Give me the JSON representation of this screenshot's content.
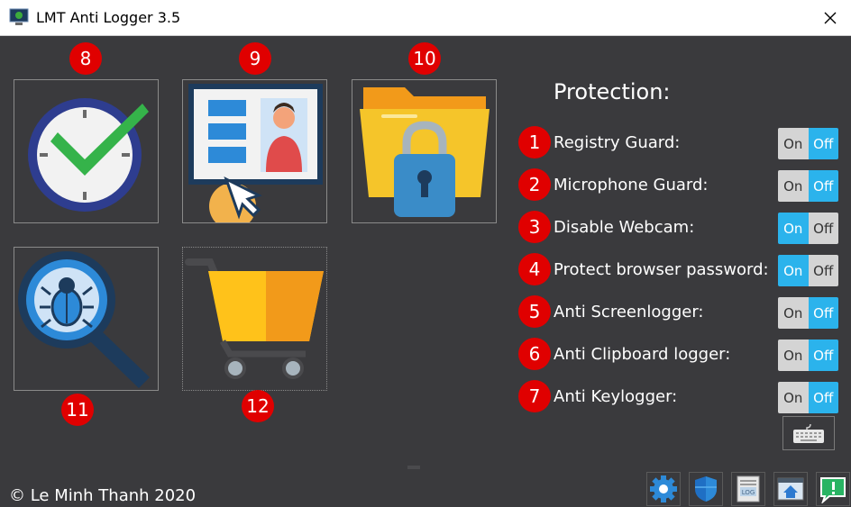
{
  "window": {
    "title": "LMT Anti Logger 3.5"
  },
  "tiles": [
    {
      "badge": "8",
      "icon": "clock-check-icon"
    },
    {
      "badge": "9",
      "icon": "profile-screen-icon"
    },
    {
      "badge": "10",
      "icon": "locked-folder-icon"
    },
    {
      "badge": "11",
      "icon": "bug-search-icon"
    },
    {
      "badge": "12",
      "icon": "shopping-cart-icon"
    }
  ],
  "protection": {
    "title": "Protection:",
    "items": [
      {
        "badge": "1",
        "label": "Registry Guard:",
        "on": "On",
        "off": "Off",
        "state": "off"
      },
      {
        "badge": "2",
        "label": "Microphone Guard:",
        "on": "On",
        "off": "Off",
        "state": "off"
      },
      {
        "badge": "3",
        "label": "Disable Webcam:",
        "on": "On",
        "off": "Off",
        "state": "on"
      },
      {
        "badge": "4",
        "label": "Protect browser password:",
        "on": "On",
        "off": "Off",
        "state": "on"
      },
      {
        "badge": "5",
        "label": "Anti Screenlogger:",
        "on": "On",
        "off": "Off",
        "state": "off"
      },
      {
        "badge": "6",
        "label": "Anti Clipboard logger:",
        "on": "On",
        "off": "Off",
        "state": "off"
      },
      {
        "badge": "7",
        "label": "Anti Keylogger:",
        "on": "On",
        "off": "Off",
        "state": "off"
      }
    ]
  },
  "footer": {
    "copyright": "© Le Minh Thanh 2020",
    "dock": [
      "settings-gear-icon",
      "shield-icon",
      "log-file-icon",
      "home-window-icon",
      "feedback-icon"
    ],
    "log_label": "LOG"
  },
  "colors": {
    "background": "#3a3a3d",
    "toggle_active": "#2bb3ec",
    "toggle_inactive": "#d4d4d4",
    "badge": "#e00000"
  }
}
